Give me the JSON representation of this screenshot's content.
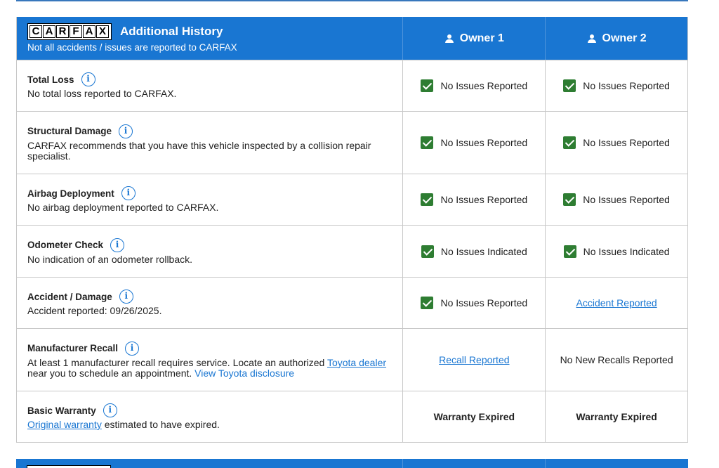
{
  "header": {
    "logo_letters": [
      "C",
      "A",
      "R",
      "F",
      "A",
      "X"
    ],
    "title": "Additional History",
    "subtitle": "Not all accidents / issues are reported to CARFAX",
    "owners": [
      "Owner 1",
      "Owner 2"
    ]
  },
  "rows": [
    {
      "title": "Total Loss",
      "desc": "No total loss reported to CARFAX.",
      "owner1": {
        "text": "No Issues Reported",
        "check": true
      },
      "owner2": {
        "text": "No Issues Reported",
        "check": true
      }
    },
    {
      "title": "Structural Damage",
      "desc": "CARFAX recommends that you have this vehicle inspected by a collision repair specialist.",
      "owner1": {
        "text": "No Issues Reported",
        "check": true
      },
      "owner2": {
        "text": "No Issues Reported",
        "check": true
      }
    },
    {
      "title": "Airbag Deployment",
      "desc": "No airbag deployment reported to CARFAX.",
      "owner1": {
        "text": "No Issues Reported",
        "check": true
      },
      "owner2": {
        "text": "No Issues Reported",
        "check": true
      }
    },
    {
      "title": "Odometer Check",
      "desc": "No indication of an odometer rollback.",
      "owner1": {
        "text": "No Issues Indicated",
        "check": true
      },
      "owner2": {
        "text": "No Issues Indicated",
        "check": true
      }
    },
    {
      "title": "Accident / Damage",
      "desc": "Accident reported: 09/26/2025.",
      "owner1": {
        "text": "No Issues Reported",
        "check": true
      },
      "owner2": {
        "text": "Accident Reported",
        "link": true
      }
    },
    {
      "title": "Manufacturer Recall",
      "desc_pre": "At least 1 manufacturer recall requires service. Locate an authorized ",
      "desc_link": "Toyota dealer",
      "desc_post": " near you to schedule an appointment. ",
      "desc_link2": "View Toyota disclosure",
      "owner1": {
        "text": "Recall Reported",
        "link": true
      },
      "owner2": {
        "text": "No New Recalls Reported"
      }
    },
    {
      "title": "Basic Warranty",
      "desc_link": "Original warranty",
      "desc_post": " estimated to have expired.",
      "owner1": {
        "text": "Warranty Expired",
        "bold": true
      },
      "owner2": {
        "text": "Warranty Expired",
        "bold": true
      }
    }
  ],
  "colors": {
    "header_bg": "#1976d2",
    "check_green": "#2e7d32",
    "link_blue": "#1976d2"
  }
}
